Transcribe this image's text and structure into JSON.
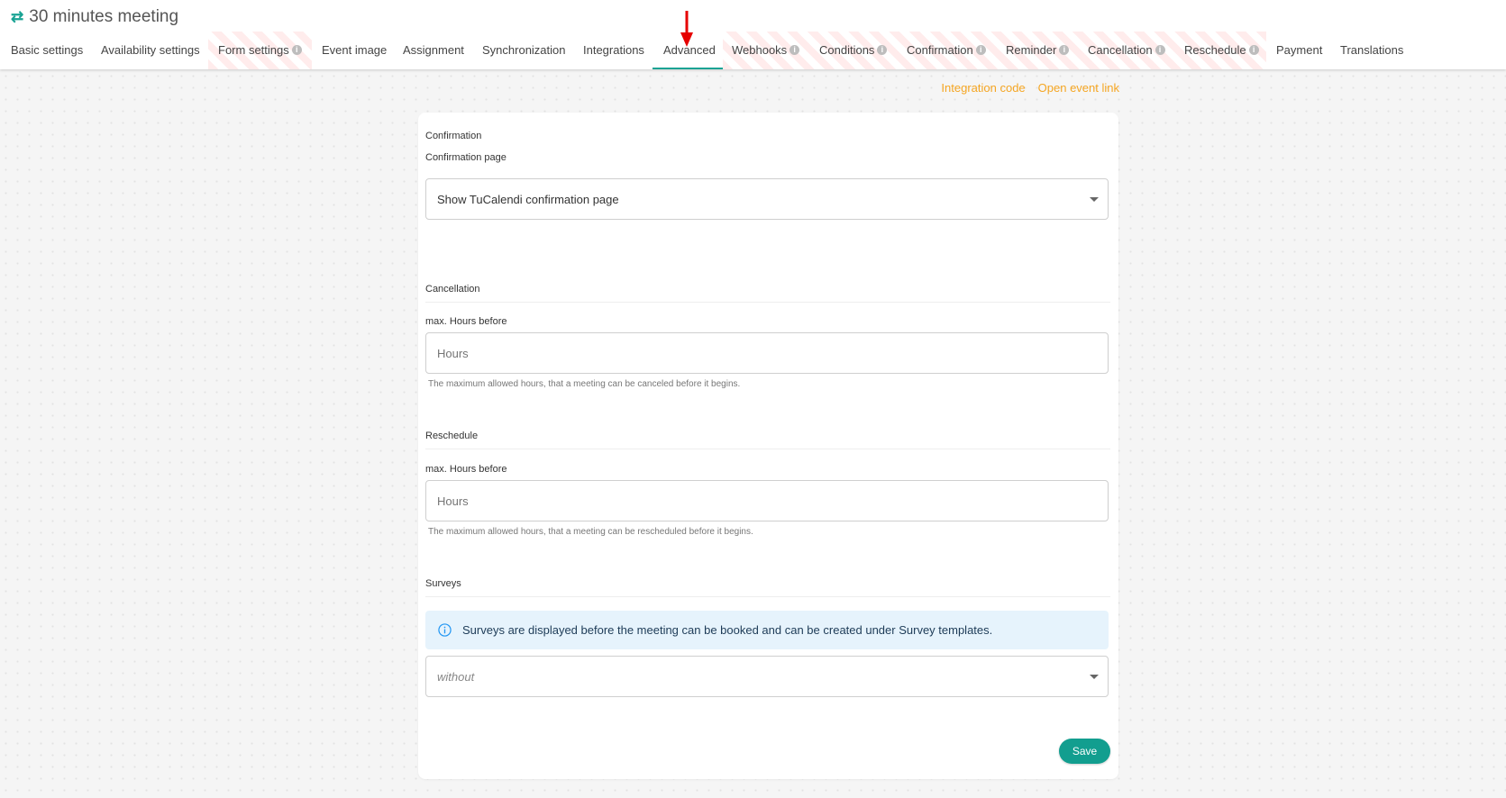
{
  "header": {
    "title": "30 minutes meeting",
    "title_icon": "swap-arrows-icon",
    "tabs": [
      {
        "label": "Basic settings",
        "info": false,
        "striped": false,
        "active": false
      },
      {
        "label": "Availability settings",
        "info": false,
        "striped": false,
        "active": false
      },
      {
        "label": "Form settings",
        "info": true,
        "striped": true,
        "active": false
      },
      {
        "label": "Event image",
        "info": false,
        "striped": false,
        "active": false
      },
      {
        "label": "Assignment",
        "info": false,
        "striped": false,
        "active": false
      },
      {
        "label": "Synchronization",
        "info": false,
        "striped": false,
        "active": false
      },
      {
        "label": "Integrations",
        "info": false,
        "striped": false,
        "active": false
      },
      {
        "label": "Advanced",
        "info": false,
        "striped": false,
        "active": true
      },
      {
        "label": "Webhooks",
        "info": true,
        "striped": true,
        "active": false
      },
      {
        "label": "Conditions",
        "info": true,
        "striped": true,
        "active": false
      },
      {
        "label": "Confirmation",
        "info": true,
        "striped": true,
        "active": false
      },
      {
        "label": "Reminder",
        "info": true,
        "striped": true,
        "active": false
      },
      {
        "label": "Cancellation",
        "info": true,
        "striped": true,
        "active": false
      },
      {
        "label": "Reschedule",
        "info": true,
        "striped": true,
        "active": false
      },
      {
        "label": "Payment",
        "info": false,
        "striped": false,
        "active": false
      },
      {
        "label": "Translations",
        "info": false,
        "striped": false,
        "active": false
      }
    ],
    "info_glyph": "i"
  },
  "links": {
    "integration_code": "Integration code",
    "open_event_link": "Open event link"
  },
  "form": {
    "confirmation": {
      "heading": "Confirmation",
      "page_label": "Confirmation page",
      "page_value": "Show TuCalendi confirmation page"
    },
    "cancellation": {
      "heading": "Cancellation",
      "label": "max. Hours before",
      "placeholder": "Hours",
      "value": "",
      "hint": "The maximum allowed hours, that a meeting can be canceled before it begins."
    },
    "reschedule": {
      "heading": "Reschedule",
      "label": "max. Hours before",
      "placeholder": "Hours",
      "value": "",
      "hint": "The maximum allowed hours, that a meeting can be rescheduled before it begins."
    },
    "surveys": {
      "heading": "Surveys",
      "info": "Surveys are displayed before the meeting can be booked and can be created under Survey templates.",
      "select_value": "without"
    },
    "save_label": "Save"
  },
  "colors": {
    "accent": "#1aa394",
    "link": "#f5a623",
    "annotation_arrow": "#e60000",
    "info_bg": "#e6f3fc"
  }
}
